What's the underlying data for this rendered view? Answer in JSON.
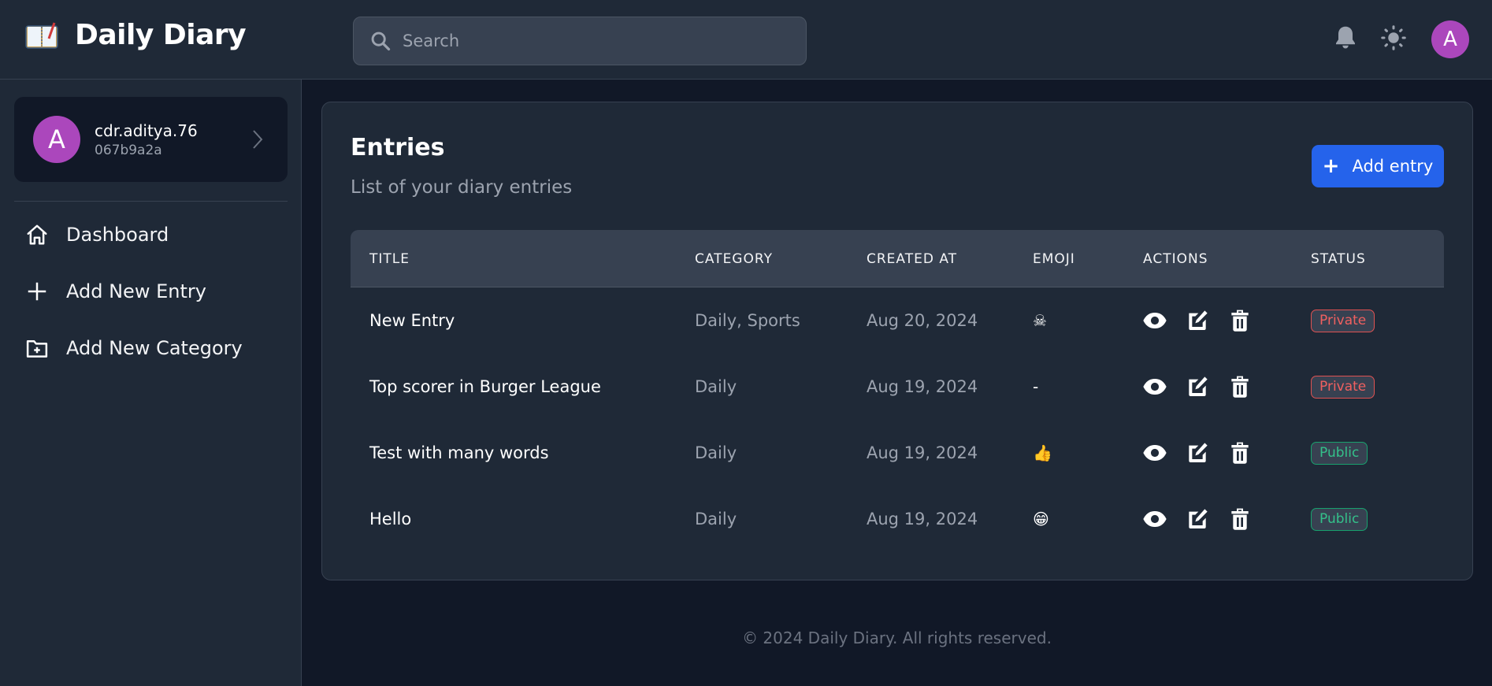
{
  "app": {
    "title": "Daily Diary",
    "logo_icon": "notebook-with-pen-icon"
  },
  "header": {
    "search": {
      "placeholder": "Search",
      "value": ""
    },
    "icons": [
      "bell-icon",
      "sun-icon"
    ],
    "avatar_initial": "A"
  },
  "sidebar": {
    "profile": {
      "initial": "A",
      "username": "cdr.aditya.76",
      "user_id": "067b9a2a"
    },
    "items": [
      {
        "label": "Dashboard",
        "icon": "home-icon"
      },
      {
        "label": "Add New Entry",
        "icon": "plus-icon"
      },
      {
        "label": "Add New Category",
        "icon": "folder-plus-icon"
      }
    ]
  },
  "main": {
    "title": "Entries",
    "subtitle": "List of your diary entries",
    "add_button_label": "Add entry",
    "table": {
      "columns": [
        "TITLE",
        "CATEGORY",
        "CREATED AT",
        "EMOJI",
        "ACTIONS",
        "STATUS"
      ],
      "rows": [
        {
          "title": "New Entry",
          "category": "Daily, Sports",
          "created_at": "Aug 20, 2024",
          "emoji": "☠",
          "status": "Private"
        },
        {
          "title": "Top scorer in Burger League",
          "category": "Daily",
          "created_at": "Aug 19, 2024",
          "emoji": "-",
          "status": "Private"
        },
        {
          "title": "Test with many words",
          "category": "Daily",
          "created_at": "Aug 19, 2024",
          "emoji": "👍",
          "status": "Public"
        },
        {
          "title": "Hello",
          "category": "Daily",
          "created_at": "Aug 19, 2024",
          "emoji": "😁",
          "status": "Public"
        }
      ]
    }
  },
  "footer": {
    "text": "© 2024 Daily Diary. All rights reserved."
  },
  "colors": {
    "accent": "#2563eb",
    "avatar": "#ab47bc",
    "private": "#f06060",
    "public": "#34c08a"
  }
}
